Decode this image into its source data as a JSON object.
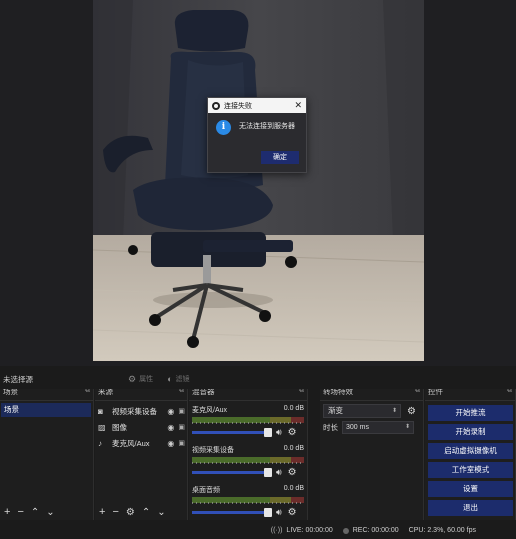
{
  "preview": {
    "camera": "camera-preview-office-chair"
  },
  "dialog": {
    "title": "连接失败",
    "close": "✕",
    "info": "i",
    "message": "无法连接到服务器",
    "ok": "确定"
  },
  "toolbar": {
    "no_source": "未选择源",
    "properties": "属性",
    "filters": "滤镜"
  },
  "scenes": {
    "title": "场景",
    "items": [
      "场景"
    ]
  },
  "sources": {
    "title": "来源",
    "items": [
      {
        "label": "视频采集设备",
        "icon": "camera-icon"
      },
      {
        "label": "图像",
        "icon": "image-icon"
      },
      {
        "label": "麦克风/Aux",
        "icon": "microphone-icon"
      }
    ]
  },
  "mixer": {
    "title": "混音器",
    "channels": [
      {
        "name": "麦克风/Aux",
        "db": "0.0 dB"
      },
      {
        "name": "视频采集设备",
        "db": "0.0 dB"
      },
      {
        "name": "桌面音频",
        "db": "0.0 dB"
      }
    ]
  },
  "transitions": {
    "title": "转场特效",
    "selected": "渐变",
    "duration_label": "时长",
    "duration": "300 ms"
  },
  "controls": {
    "title": "控件",
    "buttons": [
      "开始推流",
      "开始录制",
      "启动虚拟摄像机",
      "工作室模式",
      "设置",
      "退出"
    ]
  },
  "status": {
    "live": "LIVE: 00:00:00",
    "rec": "REC: 00:00:00",
    "cpu": "CPU: 2.3%, 60.00 fps"
  },
  "colors": {
    "accent": "#1c2c6c",
    "info": "#2a8ae6",
    "panel": "#1e1e1e"
  }
}
